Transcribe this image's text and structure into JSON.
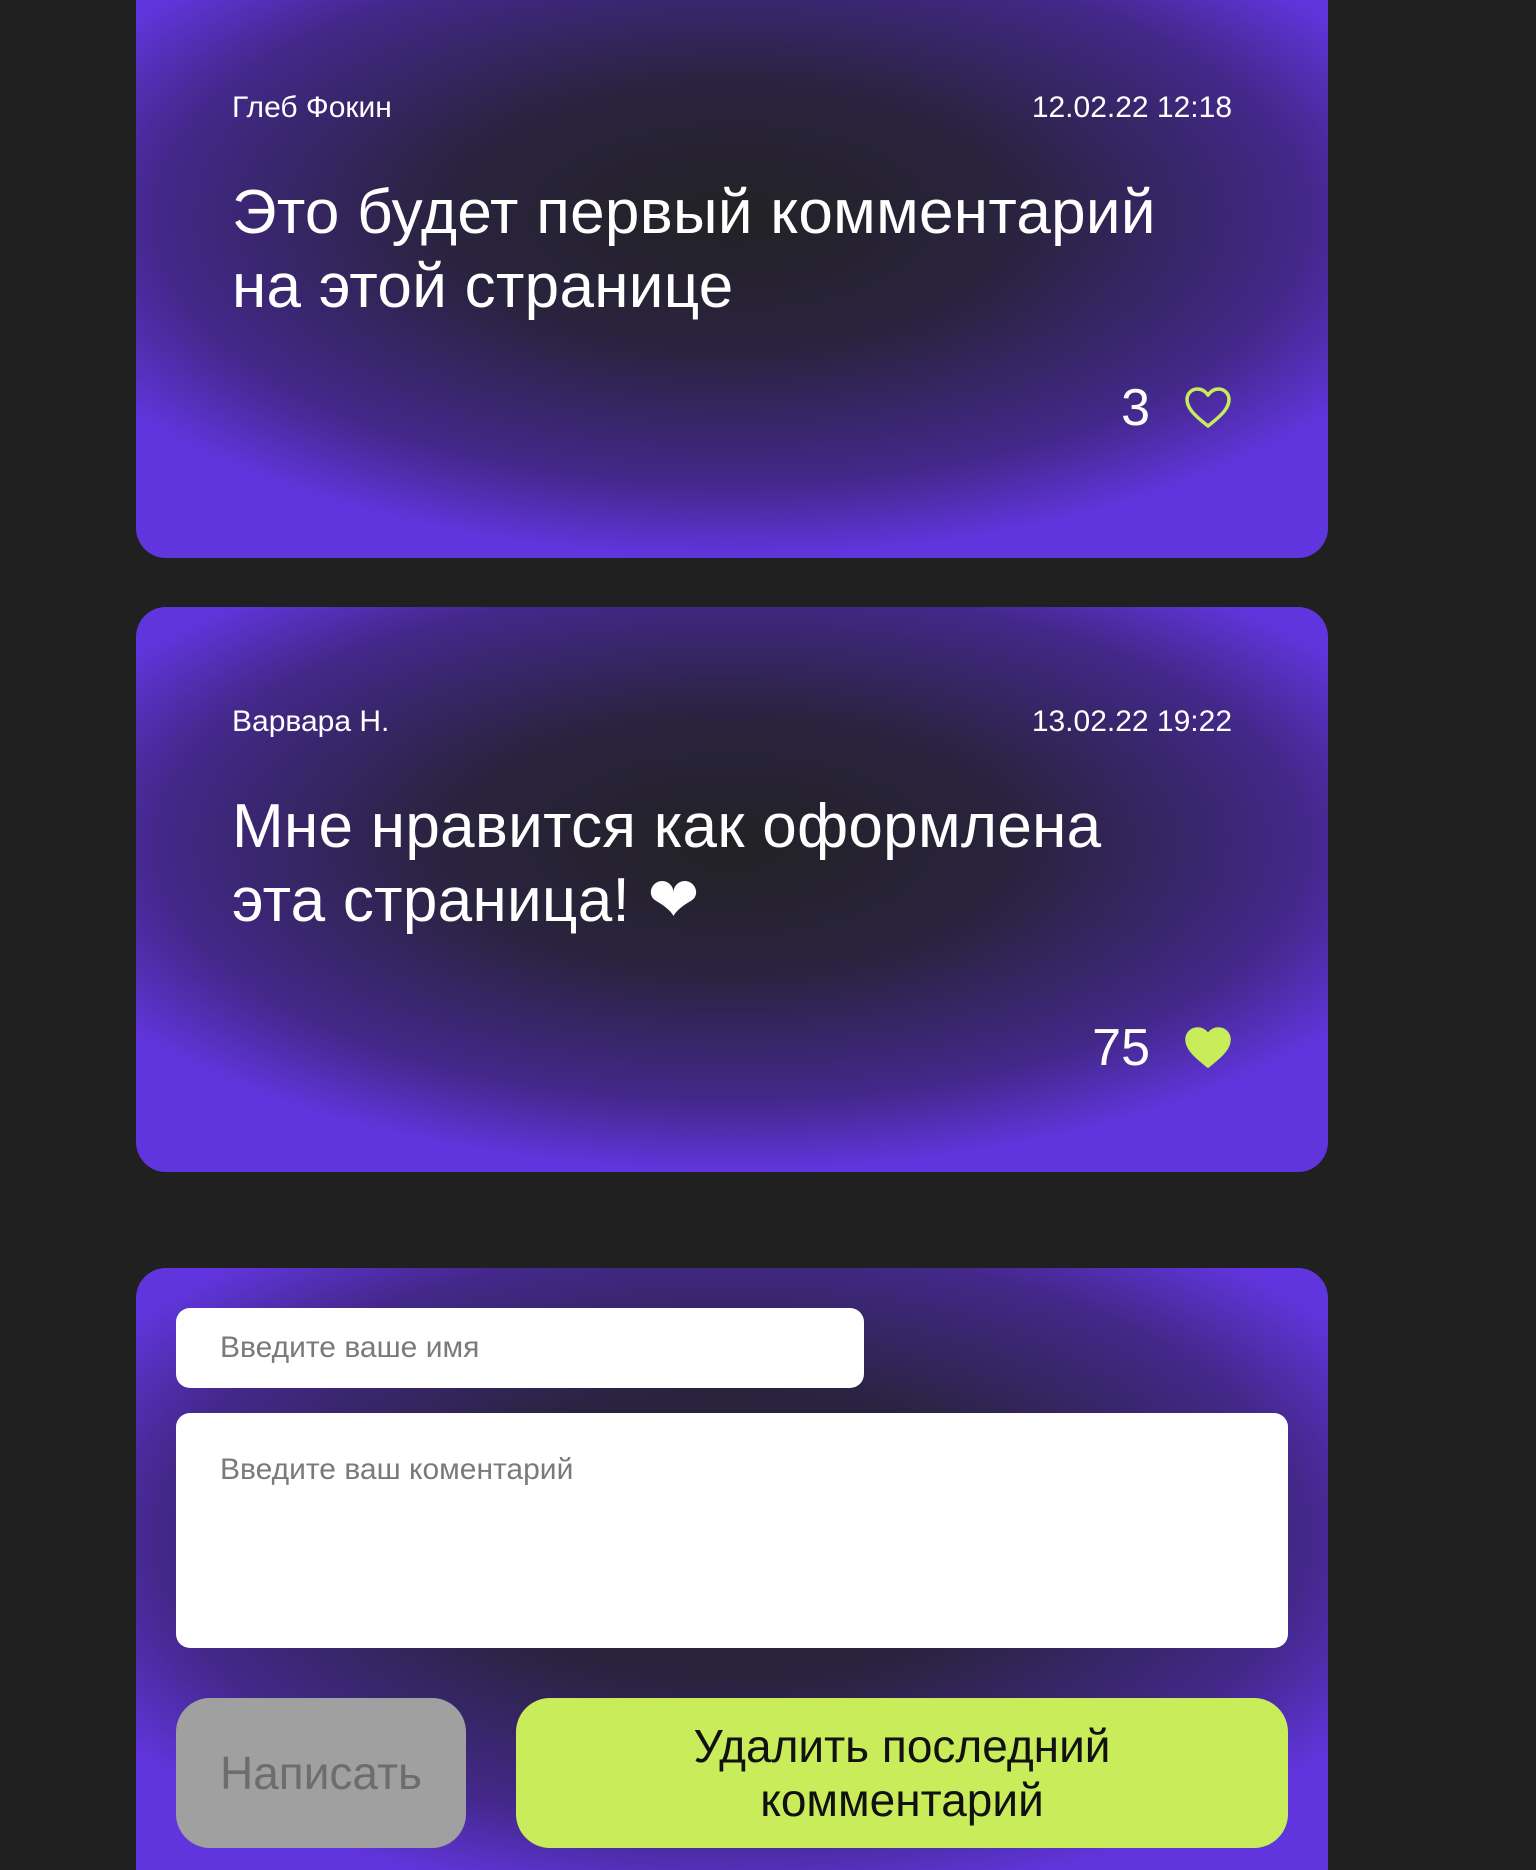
{
  "comments": [
    {
      "author": "Глеб Фокин",
      "date": "12.02.22 12:18",
      "text": "Это будет первый комментарий\nна этой странице",
      "likes": "3",
      "liked": false
    },
    {
      "author": "Варвара Н.",
      "date": "13.02.22 19:22",
      "text": "Мне нравится как оформлена\nэта страница! ❤",
      "likes": "75",
      "liked": true
    }
  ],
  "form": {
    "name_placeholder": "Введите ваше имя",
    "comment_placeholder": "Введите ваш коментарий",
    "write_label": "Написать",
    "delete_label": "Удалить последний\nкомментарий"
  },
  "colors": {
    "accent": "#c8ec5a",
    "card_edge": "#6135de",
    "background": "#202020",
    "disabled_button": "#a0a0a0"
  }
}
